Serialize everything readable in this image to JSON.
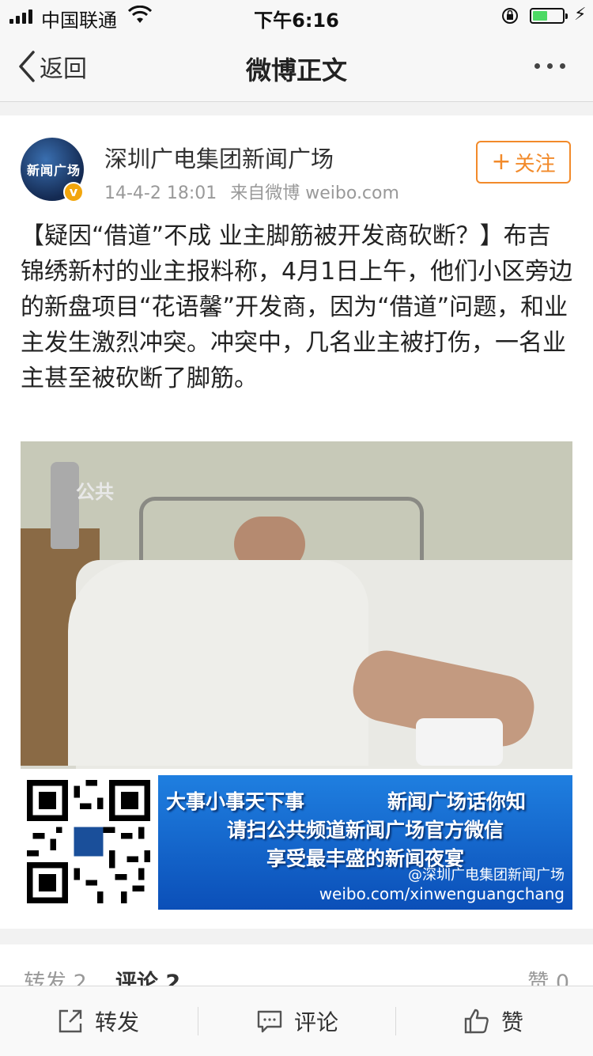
{
  "status_bar": {
    "carrier": "中国联通",
    "time": "下午6:16"
  },
  "nav": {
    "back_label": "返回",
    "title": "微博正文"
  },
  "post": {
    "username": "深圳广电集团新闻广场",
    "timestamp": "14-4-2 18:01",
    "source": "来自微博 weibo.com",
    "follow_label": "关注",
    "avatar_text": "新闻广场",
    "verified_mark": "v",
    "text": "【疑因“借道”不成 业主脚筋被开发商砍断？】布吉锦绣新村的业主报料称，4月1日上午，他们小区旁边的新盘项目“花语馨”开发商，因为“借道”问题，和业主发生激烈冲突。冲突中，几名业主被打伤，一名业主甚至被砍断了脚筋。"
  },
  "image": {
    "channel_watermark": "公共",
    "banner_line1a": "大事小事天下事",
    "banner_line1b": "新闻广场话你知",
    "banner_line2": "请扫公共频道新闻广场官方微信",
    "banner_line3": "享受最丰盛的新闻夜宴",
    "banner_handle": "@深圳广电集团新闻广场",
    "banner_url": "weibo.com/xinwenguangchang"
  },
  "stats": {
    "repost": "转发 2",
    "comment": "评论 2",
    "like": "赞 0"
  },
  "toolbar": {
    "repost": "转发",
    "comment": "评论",
    "like": "赞"
  },
  "colors": {
    "accent_orange": "#f28a2a",
    "battery_green": "#4cd964",
    "verified_badge": "#f2a60d"
  }
}
